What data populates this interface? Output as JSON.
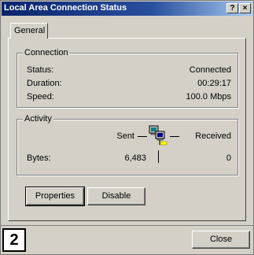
{
  "window": {
    "title": "Local Area Connection Status",
    "help_label": "?",
    "close_label": "×"
  },
  "tabs": [
    {
      "label": "General"
    }
  ],
  "connection": {
    "group_label": "Connection",
    "rows": [
      {
        "label": "Status:",
        "value": "Connected"
      },
      {
        "label": "Duration:",
        "value": "00:29:17"
      },
      {
        "label": "Speed:",
        "value": "100.0 Mbps"
      }
    ]
  },
  "activity": {
    "group_label": "Activity",
    "sent_label": "Sent",
    "received_label": "Received",
    "bytes_label": "Bytes:",
    "sent_bytes": "6,483",
    "received_bytes": "0",
    "icon": "network-computers-icon"
  },
  "buttons": {
    "properties": "Properties",
    "disable": "Disable",
    "close": "Close"
  },
  "step_badge": "2"
}
